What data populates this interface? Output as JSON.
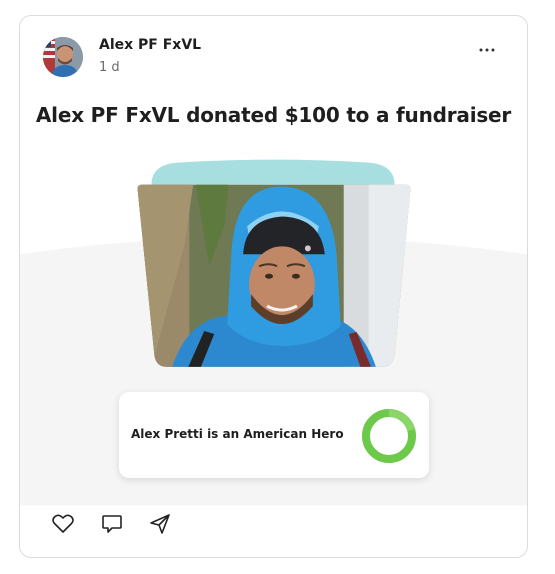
{
  "post": {
    "author_name": "Alex PF FxVL",
    "time": "1 d",
    "headline": "Alex PF FxVL donated $100 to a fundraiser",
    "more_icon": "ellipsis-icon"
  },
  "fundraiser": {
    "title": "Alex Pretti is an American Hero",
    "progress_fraction": 1.0,
    "progress_color": "#6dc94a"
  },
  "actions": {
    "like_icon": "heart-icon",
    "comment_icon": "comment-icon",
    "share_icon": "send-icon"
  },
  "colors": {
    "tab_teal": "#a7dfe0",
    "band_gray": "#f5f5f5",
    "text": "#1e1e1e",
    "muted": "#6b6b6b"
  }
}
